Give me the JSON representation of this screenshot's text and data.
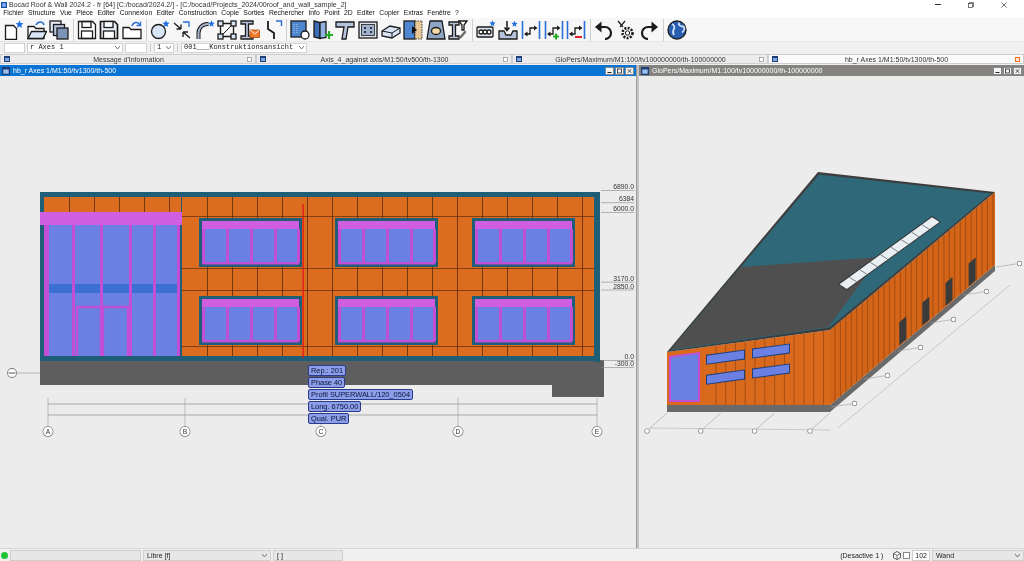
{
  "window": {
    "title": "Bocad Roof & Wall 2024.2 - fr [64]  [C:/bocad/2024.2/]  -  [C:/bocad/Projects_2024/00roof_and_wall_sample_2]"
  },
  "menu": [
    "Fichier",
    "Structure",
    "Vue",
    "Pièce",
    "Editer",
    "Connexion",
    "Editer",
    "Construction",
    "Copie",
    "Sorties",
    "Rechercher",
    "Info",
    "Point",
    "2D",
    "Editer",
    "Copier",
    "Extras",
    "Fenêtre",
    "?"
  ],
  "selectors": [
    {
      "kind": "field"
    },
    {
      "kind": "dropdown",
      "value": "r Axes 1"
    },
    {
      "kind": "field"
    },
    {
      "kind": "dropdown",
      "value": "1"
    },
    {
      "kind": "dropdown",
      "value": "001___Konstruktionsansicht"
    }
  ],
  "panel_tabs": [
    {
      "label": "Message d'Information",
      "selected": false
    },
    {
      "label": "Axis_4_against axis/M1:50/tv500/th-1300",
      "selected": false
    },
    {
      "label": "GloPers/Maximum/M1:100/tv100000000/th-100000000",
      "selected": false
    },
    {
      "label": "hb_r Axes 1/M1:50/tv1300/th-500",
      "selected": true
    }
  ],
  "views": [
    {
      "kind": "elevation",
      "title": "hb_r Axes 1/M1:50/tv1300/th-500",
      "active": true,
      "levels": [
        "6890.0",
        "6384",
        "6000.0",
        "3170.0",
        "2850.0",
        "0.0",
        "-300.0"
      ],
      "axes": [
        "A",
        "B",
        "C",
        "D",
        "E"
      ],
      "tooltip": [
        "Rep.: 201",
        "Phase 40",
        "Profil SUPERWALL/120_0504",
        "Long. 6750.00",
        "Qual. PUR"
      ]
    },
    {
      "kind": "perspective",
      "title": "GloPers/Maximum/M1:100/tv100000000/th-100000000",
      "active": false
    }
  ],
  "status_bar": {
    "fields": [
      {
        "kind": "field"
      },
      {
        "kind": "dropdown",
        "value": "Libre [f]"
      },
      {
        "kind": "field",
        "value": "[ ]"
      }
    ],
    "message": "(Desactive 1 )",
    "checkbox": {
      "checked": false
    },
    "code": "102",
    "dropdown": {
      "value": "Wand"
    }
  }
}
